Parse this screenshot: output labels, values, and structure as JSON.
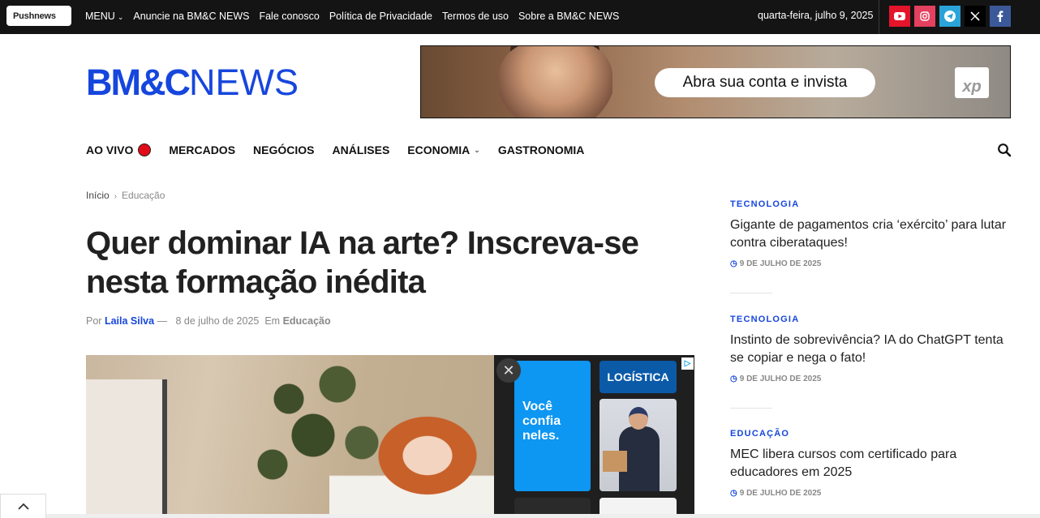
{
  "topbar": {
    "pushnews_label": "Pushnews",
    "menu_label": "MENU",
    "links": [
      "Anuncie na BM&C NEWS",
      "Fale conosco",
      "Política de Privacidade",
      "Termos de uso",
      "Sobre a BM&C NEWS"
    ],
    "date": "quarta-feira, julho 9, 2025",
    "social": [
      {
        "name": "youtube-icon",
        "color": "#e4142a"
      },
      {
        "name": "instagram-icon",
        "color": "#e4405f"
      },
      {
        "name": "telegram-icon",
        "color": "#2aa3d9"
      },
      {
        "name": "x-icon",
        "color": "#000000"
      },
      {
        "name": "facebook-icon",
        "color": "#3b5998"
      }
    ]
  },
  "header": {
    "logo_bold": "BM&C",
    "logo_thin": "NEWS",
    "ad_cta": "Abra sua conta e invista",
    "ad_brand": "xp"
  },
  "mainnav": {
    "items": [
      "AO VIVO",
      "MERCADOS",
      "NEGÓCIOS",
      "ANÁLISES",
      "ECONOMIA",
      "GASTRONOMIA"
    ]
  },
  "article": {
    "breadcrumb_home": "Início",
    "breadcrumb_current": "Educação",
    "title": "Quer dominar IA na arte? Inscreva-se nesta formação inédita",
    "by_label": "Por",
    "author": "Laila Silva",
    "dash": "—",
    "date": "8 de julho de 2025",
    "in_label": "Em",
    "category": "Educação"
  },
  "ad_box": {
    "blue_text": "Você confia neles.",
    "tag": "LOGÍSTICA",
    "close_symbol": "✕",
    "adchoice_symbol": "▷"
  },
  "sidebar": {
    "items": [
      {
        "category": "TECNOLOGIA",
        "title": "Gigante de pagamentos cria ‘exército’ para lutar contra ciberataques!",
        "date": "9 DE JULHO DE 2025"
      },
      {
        "category": "TECNOLOGIA",
        "title": "Instinto de sobrevivência? IA do ChatGPT tenta se copiar e nega o fato!",
        "date": "9 DE JULHO DE 2025"
      },
      {
        "category": "EDUCAÇÃO",
        "title": "MEC libera cursos com certificado para educadores em 2025",
        "date": "9 DE JULHO DE 2025"
      }
    ]
  },
  "colors": {
    "brand_blue": "#1646dd",
    "live_red": "#e10a17",
    "topbar_bg": "#141414"
  }
}
